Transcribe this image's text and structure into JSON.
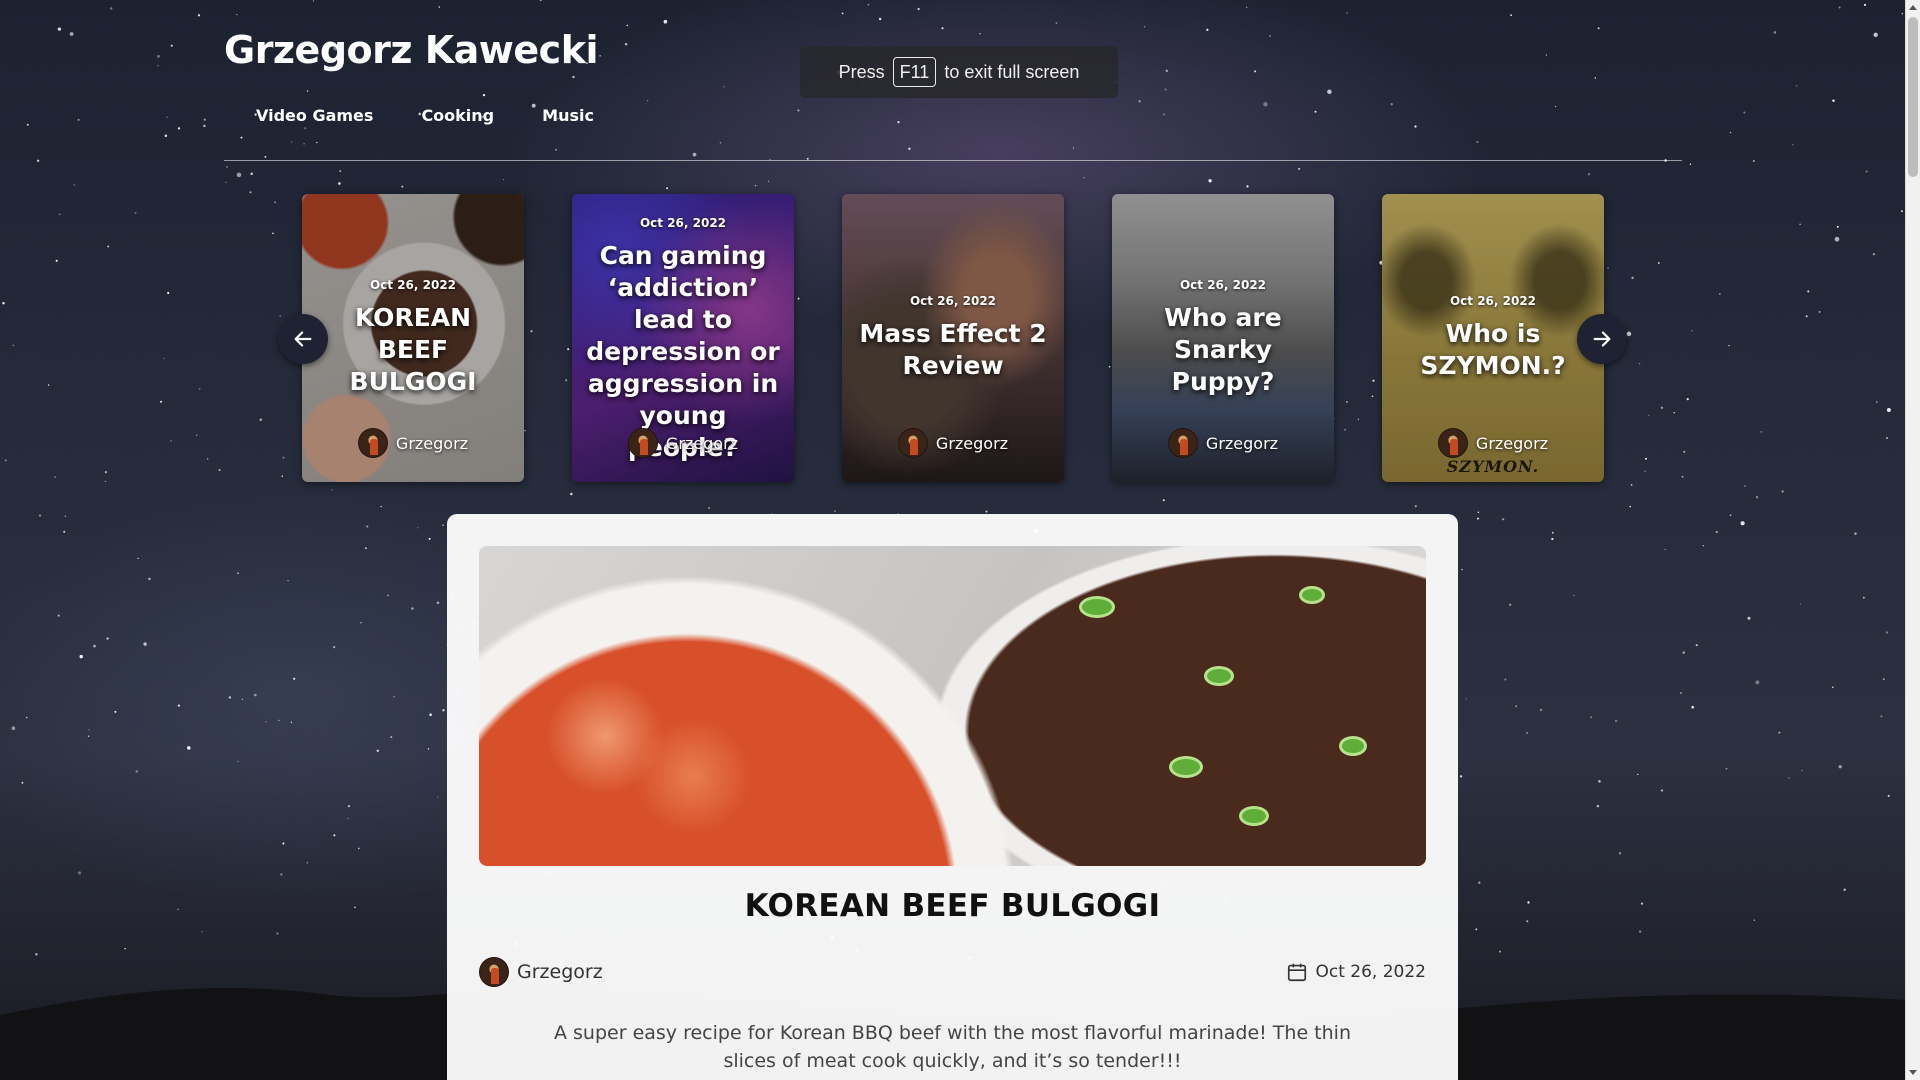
{
  "site": {
    "title": "Grzegorz Kawecki",
    "nav": [
      "Video Games",
      "Cooking",
      "Music"
    ]
  },
  "fullscreen_notice": {
    "before": "Press",
    "key": "F11",
    "after": "to exit full screen"
  },
  "carousel": {
    "prev_icon": "arrow-left-icon",
    "next_icon": "arrow-right-icon",
    "cards": [
      {
        "date": "Oct 26, 2022",
        "title": "KOREAN BEEF BULGOGI",
        "author": "Grzegorz"
      },
      {
        "date": "Oct 26, 2022",
        "title": "Can gaming ‘addiction’ lead to depression or aggression in young people?",
        "author": "Grzegorz"
      },
      {
        "date": "Oct 26, 2022",
        "title": "Mass Effect 2 Review",
        "author": "Grzegorz"
      },
      {
        "date": "Oct 26, 2022",
        "title": "Who are Snarky Puppy?",
        "author": "Grzegorz"
      },
      {
        "date": "Oct 26, 2022",
        "title": "Who is SZYMON.?",
        "author": "Grzegorz",
        "image_text": "SZYMON."
      }
    ]
  },
  "article": {
    "title": "KOREAN BEEF BULGOGI",
    "author": "Grzegorz",
    "date": "Oct 26, 2022",
    "date_icon": "calendar-icon",
    "description": "A super easy recipe for Korean BBQ beef with the most flavorful marinade! The thin slices of meat cook quickly, and it’s so tender!!!"
  }
}
